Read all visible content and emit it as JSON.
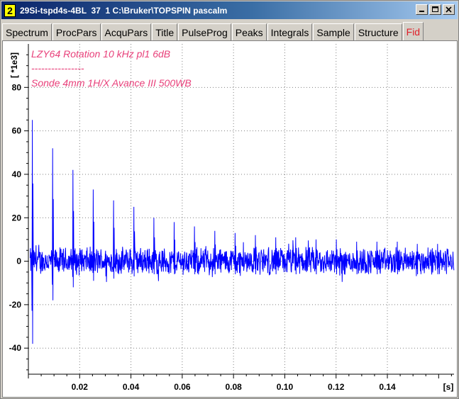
{
  "window": {
    "number": "2",
    "title": "29Si-tspd4s-4BL  37  1 C:\\Bruker\\TOPSPIN pascalm",
    "colors": {
      "title_start": "#0a246a",
      "title_end": "#a6caf0",
      "number_bg": "#ffff00"
    }
  },
  "window_buttons": {
    "minimize": "minimize-icon",
    "maximize": "maximize-icon",
    "close": "close-icon"
  },
  "tabs": [
    {
      "label": "Spectrum",
      "active": false
    },
    {
      "label": "ProcPars",
      "active": false
    },
    {
      "label": "AcquPars",
      "active": false
    },
    {
      "label": "Title",
      "active": false
    },
    {
      "label": "PulseProg",
      "active": false
    },
    {
      "label": "Peaks",
      "active": false
    },
    {
      "label": "Integrals",
      "active": false
    },
    {
      "label": "Sample",
      "active": false
    },
    {
      "label": "Structure",
      "active": false
    },
    {
      "label": "Fid",
      "active": true
    }
  ],
  "annotation": {
    "line1": "LZY64 Rotation 10 kHz pl1 6dB",
    "line2": "----------------",
    "line3": "Sonde 4mm 1H/X Avance III 500WB",
    "color": "#e8407a"
  },
  "chart_data": {
    "type": "line",
    "ylabel": "[ *1e3]",
    "xlabel": "[s]",
    "x_ticks": [
      "0.02",
      "0.04",
      "0.06",
      "0.08",
      "0.10",
      "0.12",
      "0.14"
    ],
    "y_ticks": [
      "80",
      "60",
      "40",
      "20",
      "0",
      "-20",
      "-40"
    ],
    "xlim": [
      0.0,
      0.166
    ],
    "ylim": [
      -52,
      100
    ],
    "grid": true,
    "series": [
      {
        "color": "#0000ff",
        "rotor_period_s": 0.0079,
        "noise_amplitude": 6,
        "echo_peaks": [
          {
            "x": 0.0016,
            "max": 65,
            "min": -38
          },
          {
            "x": 0.0095,
            "max": 52,
            "min": -18
          },
          {
            "x": 0.0174,
            "max": 42,
            "min": -12
          },
          {
            "x": 0.0253,
            "max": 33,
            "min": -9
          },
          {
            "x": 0.0332,
            "max": 28,
            "min": -8
          },
          {
            "x": 0.0411,
            "max": 25,
            "min": -7
          },
          {
            "x": 0.049,
            "max": 20,
            "min": -6
          },
          {
            "x": 0.0569,
            "max": 18,
            "min": -6
          },
          {
            "x": 0.0648,
            "max": 16,
            "min": -6
          },
          {
            "x": 0.0727,
            "max": 14,
            "min": -6
          },
          {
            "x": 0.0806,
            "max": 13,
            "min": -6
          },
          {
            "x": 0.0885,
            "max": 12,
            "min": -6
          },
          {
            "x": 0.0964,
            "max": 11,
            "min": -6
          },
          {
            "x": 0.1043,
            "max": 11,
            "min": -6
          },
          {
            "x": 0.1122,
            "max": 10,
            "min": -6
          },
          {
            "x": 0.1201,
            "max": 10,
            "min": -6
          },
          {
            "x": 0.128,
            "max": 9,
            "min": -6
          },
          {
            "x": 0.1359,
            "max": 9,
            "min": -6
          },
          {
            "x": 0.1438,
            "max": 9,
            "min": -6
          },
          {
            "x": 0.1517,
            "max": 8,
            "min": -6
          },
          {
            "x": 0.1596,
            "max": 8,
            "min": -6
          }
        ]
      }
    ]
  }
}
